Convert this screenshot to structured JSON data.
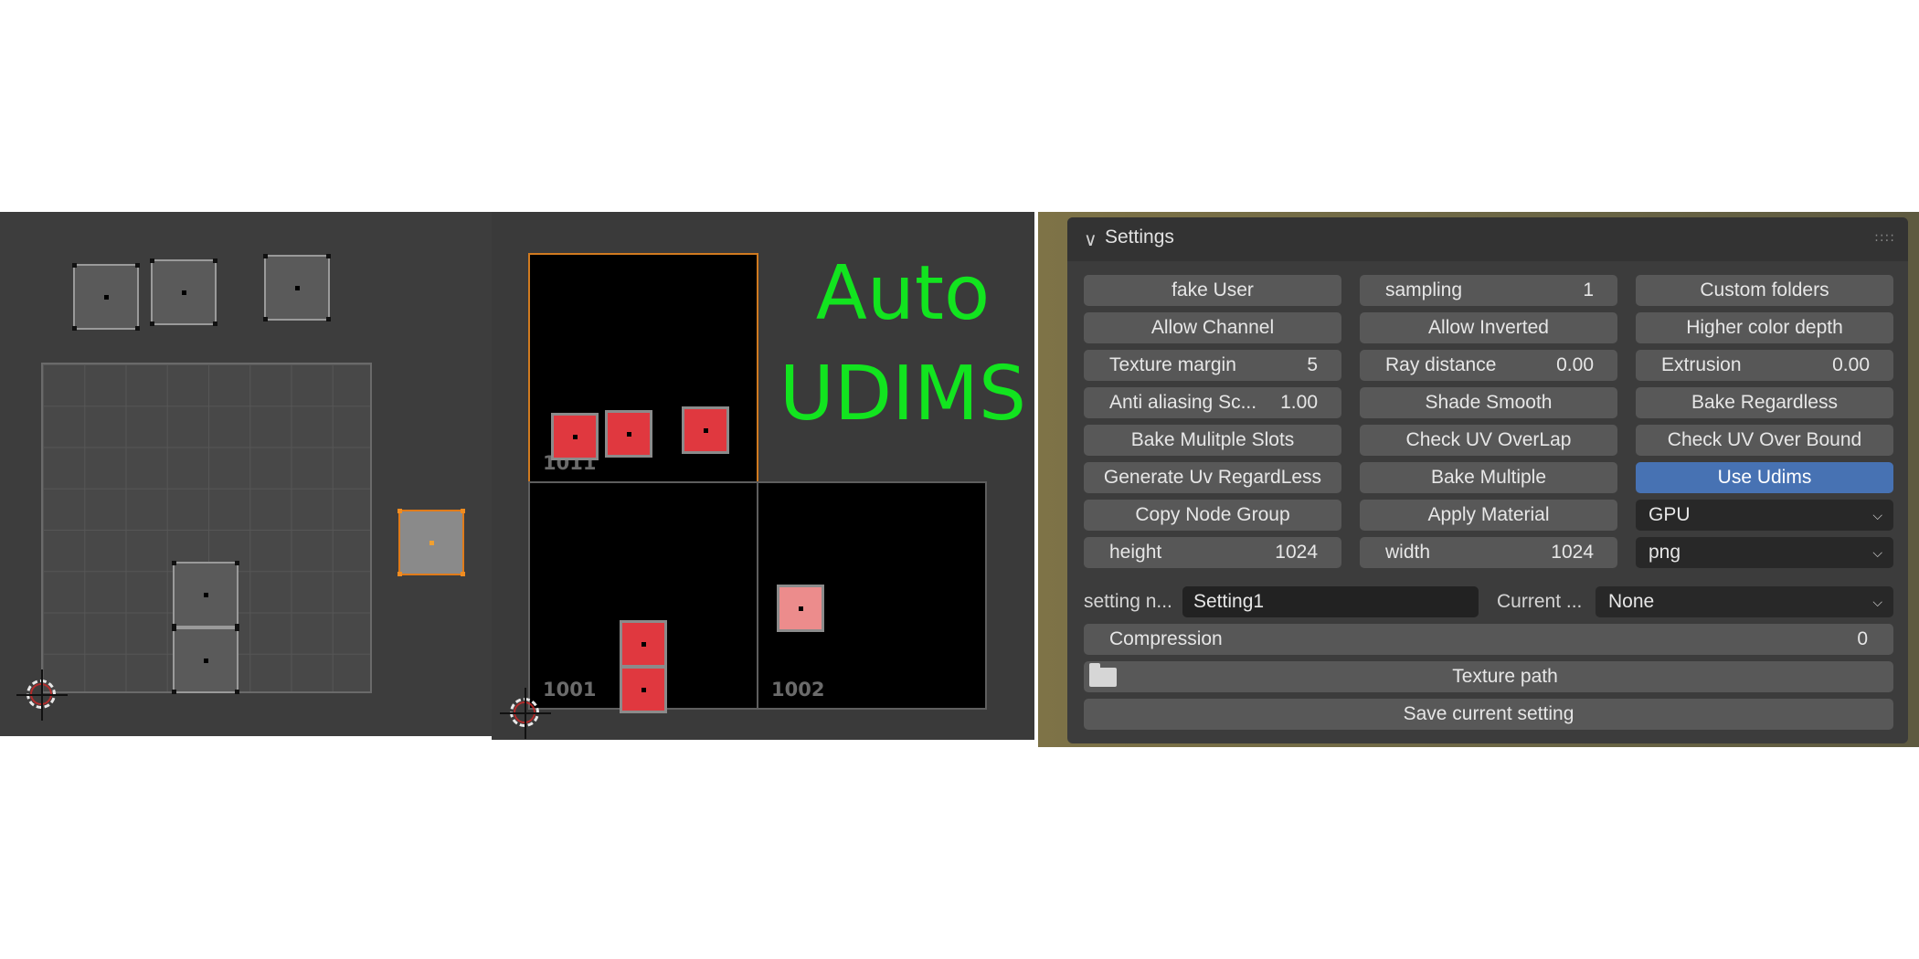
{
  "overlay": {
    "title_line1": "Auto",
    "title_line2": "UDIMS"
  },
  "uv_editor": {
    "tiles": [
      {
        "label": "1011",
        "active": true
      },
      {
        "label": "1001",
        "active": false
      },
      {
        "label": "1002",
        "active": false
      }
    ]
  },
  "settings_panel": {
    "title": "Settings",
    "buttons": {
      "fake_user": "fake User",
      "custom_folders": "Custom folders",
      "allow_channel": "Allow Channel",
      "allow_inverted": "Allow Inverted",
      "higher_color_depth": "Higher color depth",
      "shade_smooth": "Shade Smooth",
      "bake_regardless": "Bake Regardless",
      "bake_multiple_slots": "Bake Mulitple Slots",
      "check_uv_overlap": "Check UV OverLap",
      "check_uv_over_bound": "Check UV Over Bound",
      "generate_uv_regardless": "Generate Uv RegardLess",
      "bake_multiple": "Bake Multiple",
      "use_udims": "Use Udims",
      "copy_node_group": "Copy Node Group",
      "apply_material": "Apply Material",
      "texture_path": "Texture path",
      "save_current_setting": "Save current setting"
    },
    "fields": {
      "sampling": {
        "label": "sampling",
        "value": "1"
      },
      "texture_margin": {
        "label": "Texture margin",
        "value": "5"
      },
      "ray_distance": {
        "label": "Ray distance",
        "value": "0.00"
      },
      "extrusion": {
        "label": "Extrusion",
        "value": "0.00"
      },
      "anti_aliasing": {
        "label": "Anti aliasing Sc...",
        "value": "1.00"
      },
      "height": {
        "label": "height",
        "value": "1024"
      },
      "width": {
        "label": "width",
        "value": "1024"
      },
      "compression": {
        "label": "Compression",
        "value": "0"
      }
    },
    "dropdowns": {
      "device": "GPU",
      "format": "png",
      "current": "None"
    },
    "setting_name": {
      "label": "setting n...",
      "value": "Setting1"
    },
    "current_label": "Current ...",
    "accent_color": "#4772b3"
  }
}
